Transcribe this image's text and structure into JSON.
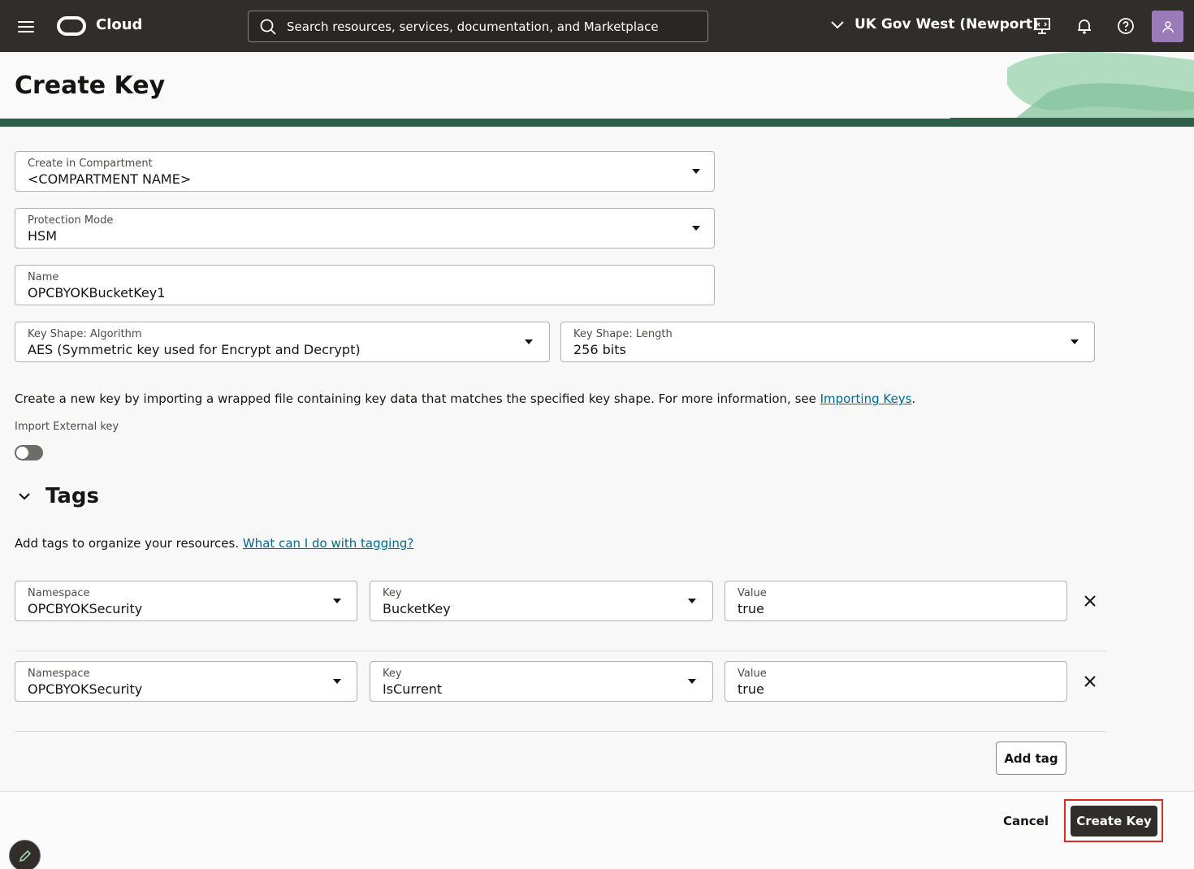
{
  "topbar": {
    "brand": "Cloud",
    "search_placeholder": "Search resources, services, documentation, and Marketplace",
    "region": "UK Gov West (Newport)",
    "icons": [
      "hamburger-icon",
      "cloud-logo-icon",
      "search-icon",
      "chevron-down-icon",
      "developer-tools-icon",
      "bell-icon",
      "help-icon",
      "user-icon"
    ]
  },
  "page": {
    "title": "Create Key"
  },
  "form": {
    "compartment": {
      "label": "Create in Compartment",
      "value": "<COMPARTMENT NAME>"
    },
    "protection_mode": {
      "label": "Protection Mode",
      "value": "HSM"
    },
    "name": {
      "label": "Name",
      "value": "OPCBYOKBucketKey1"
    },
    "algorithm": {
      "label": "Key Shape: Algorithm",
      "value": "AES (Symmetric key used for Encrypt and Decrypt)"
    },
    "length": {
      "label": "Key Shape: Length",
      "value": "256 bits"
    },
    "import_info": "Create a new key by importing a wrapped file containing key data that matches the specified key shape. For more information, see ",
    "import_link": "Importing Keys",
    "import_period": ".",
    "import_label": "Import External key"
  },
  "tags": {
    "title": "Tags",
    "description": "Add tags to organize your resources. ",
    "help_link": "What can I do with tagging?",
    "rows": [
      {
        "namespace_label": "Namespace",
        "namespace": "OPCBYOKSecurity",
        "key_label": "Key",
        "key": "BucketKey",
        "value_label": "Value",
        "value": "true"
      },
      {
        "namespace_label": "Namespace",
        "namespace": "OPCBYOKSecurity",
        "key_label": "Key",
        "key": "IsCurrent",
        "value_label": "Value",
        "value": "true"
      }
    ],
    "add_label": "Add tag"
  },
  "footer": {
    "cancel": "Cancel",
    "create": "Create Key"
  },
  "colors": {
    "topbar": "#312d2a",
    "link": "#006b8f",
    "highlight": "#e0291f",
    "avatar": "#9b7ab8"
  }
}
